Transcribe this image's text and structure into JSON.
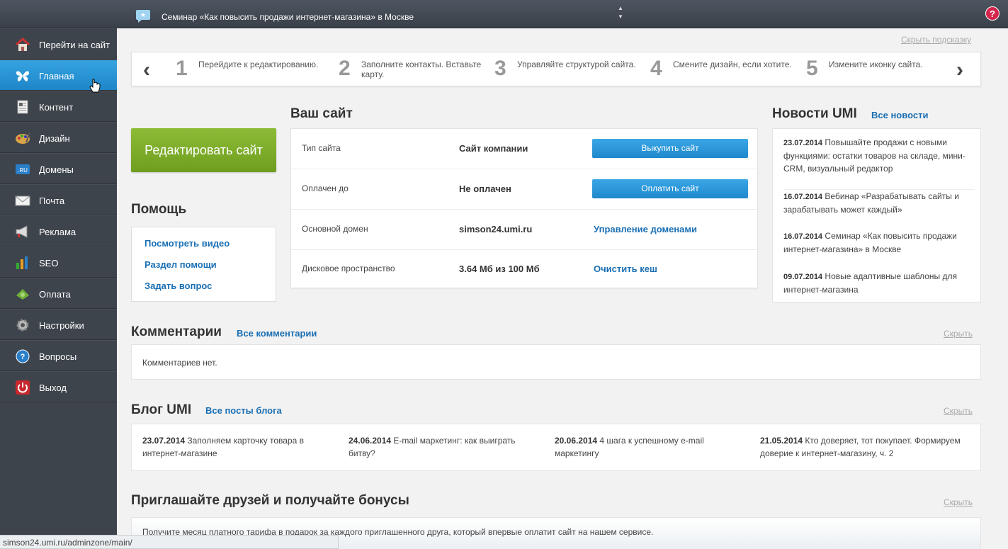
{
  "topbar": {
    "ticker": "Семинар «Как повысить продажи интернет-магазина» в Москве",
    "help": "?"
  },
  "sidebar": {
    "items": [
      {
        "label": "Перейти на сайт",
        "icon": "home-icon"
      },
      {
        "label": "Главная",
        "icon": "butterfly-icon"
      },
      {
        "label": "Контент",
        "icon": "document-icon"
      },
      {
        "label": "Дизайн",
        "icon": "palette-icon"
      },
      {
        "label": "Домены",
        "icon": "ru-domain-icon"
      },
      {
        "label": "Почта",
        "icon": "envelope-icon"
      },
      {
        "label": "Реклама",
        "icon": "megaphone-icon"
      },
      {
        "label": "SEO",
        "icon": "bar-chart-icon"
      },
      {
        "label": "Оплата",
        "icon": "money-icon"
      },
      {
        "label": "Настройки",
        "icon": "gear-icon"
      },
      {
        "label": "Вопросы",
        "icon": "question-icon"
      },
      {
        "label": "Выход",
        "icon": "power-icon"
      }
    ]
  },
  "hint": {
    "hide": "Скрыть подсказку",
    "steps": [
      {
        "num": "1",
        "text": "Перейдите к редактированию."
      },
      {
        "num": "2",
        "text": "Заполните контакты. Вставьте карту."
      },
      {
        "num": "3",
        "text": "Управляйте структурой сайта."
      },
      {
        "num": "4",
        "text": "Смените дизайн, если хотите."
      },
      {
        "num": "5",
        "text": "Измените иконку сайта."
      }
    ]
  },
  "edit_button": "Редактировать сайт",
  "help": {
    "title": "Помощь",
    "links": [
      "Посмотреть видео",
      "Раздел помощи",
      "Задать вопрос"
    ]
  },
  "site": {
    "title": "Ваш сайт",
    "rows": [
      {
        "key": "Тип сайта",
        "value": "Сайт компании",
        "action": "Выкупить сайт"
      },
      {
        "key": "Оплачен до",
        "value": "Не оплачен",
        "action": "Оплатить сайт"
      },
      {
        "key": "Основной домен",
        "value": "simson24.umi.ru",
        "action": "Управление доменами"
      },
      {
        "key": "Дисковое пространство",
        "value": "3.64 Мб из 100 Мб",
        "action": "Очистить кеш"
      }
    ]
  },
  "news": {
    "title": "Новости UMI",
    "all": "Все новости",
    "items": [
      {
        "date": "23.07.2014",
        "text": "Повышайте продажи с новыми функциями: остатки товаров на складе, мини-CRM, визуальный редактор"
      },
      {
        "date": "16.07.2014",
        "text": "Вебинар «Разрабатывать сайты и зарабатывать может каждый»"
      },
      {
        "date": "16.07.2014",
        "text": "Семинар «Как повысить продажи интернет-магазина» в Москве"
      },
      {
        "date": "09.07.2014",
        "text": "Новые адаптивные шаблоны для интернет-магазина"
      }
    ]
  },
  "comments": {
    "title": "Комментарии",
    "all": "Все комментарии",
    "hide": "Скрыть",
    "empty": "Комментариев нет."
  },
  "blog": {
    "title": "Блог UMI",
    "all": "Все посты блога",
    "hide": "Скрыть",
    "items": [
      {
        "date": "23.07.2014",
        "text": "Заполняем карточку товара в интернет-магазине"
      },
      {
        "date": "24.06.2014",
        "text": "E-mail маркетинг: как выиграть битву?"
      },
      {
        "date": "20.06.2014",
        "text": "4 шага к успешному e-mail маркетингу"
      },
      {
        "date": "21.05.2014",
        "text": "Кто доверяет, тот покупает. Формируем доверие к интернет-магазину, ч. 2"
      }
    ]
  },
  "invite": {
    "title": "Приглашайте друзей и получайте бонусы",
    "hide": "Скрыть",
    "text": "Получите месяц платного тарифа в подарок за каждого приглашенного друга, который впервые оплатит сайт на нашем сервисе."
  },
  "statusbar": "simson24.umi.ru/adminzone/main/"
}
